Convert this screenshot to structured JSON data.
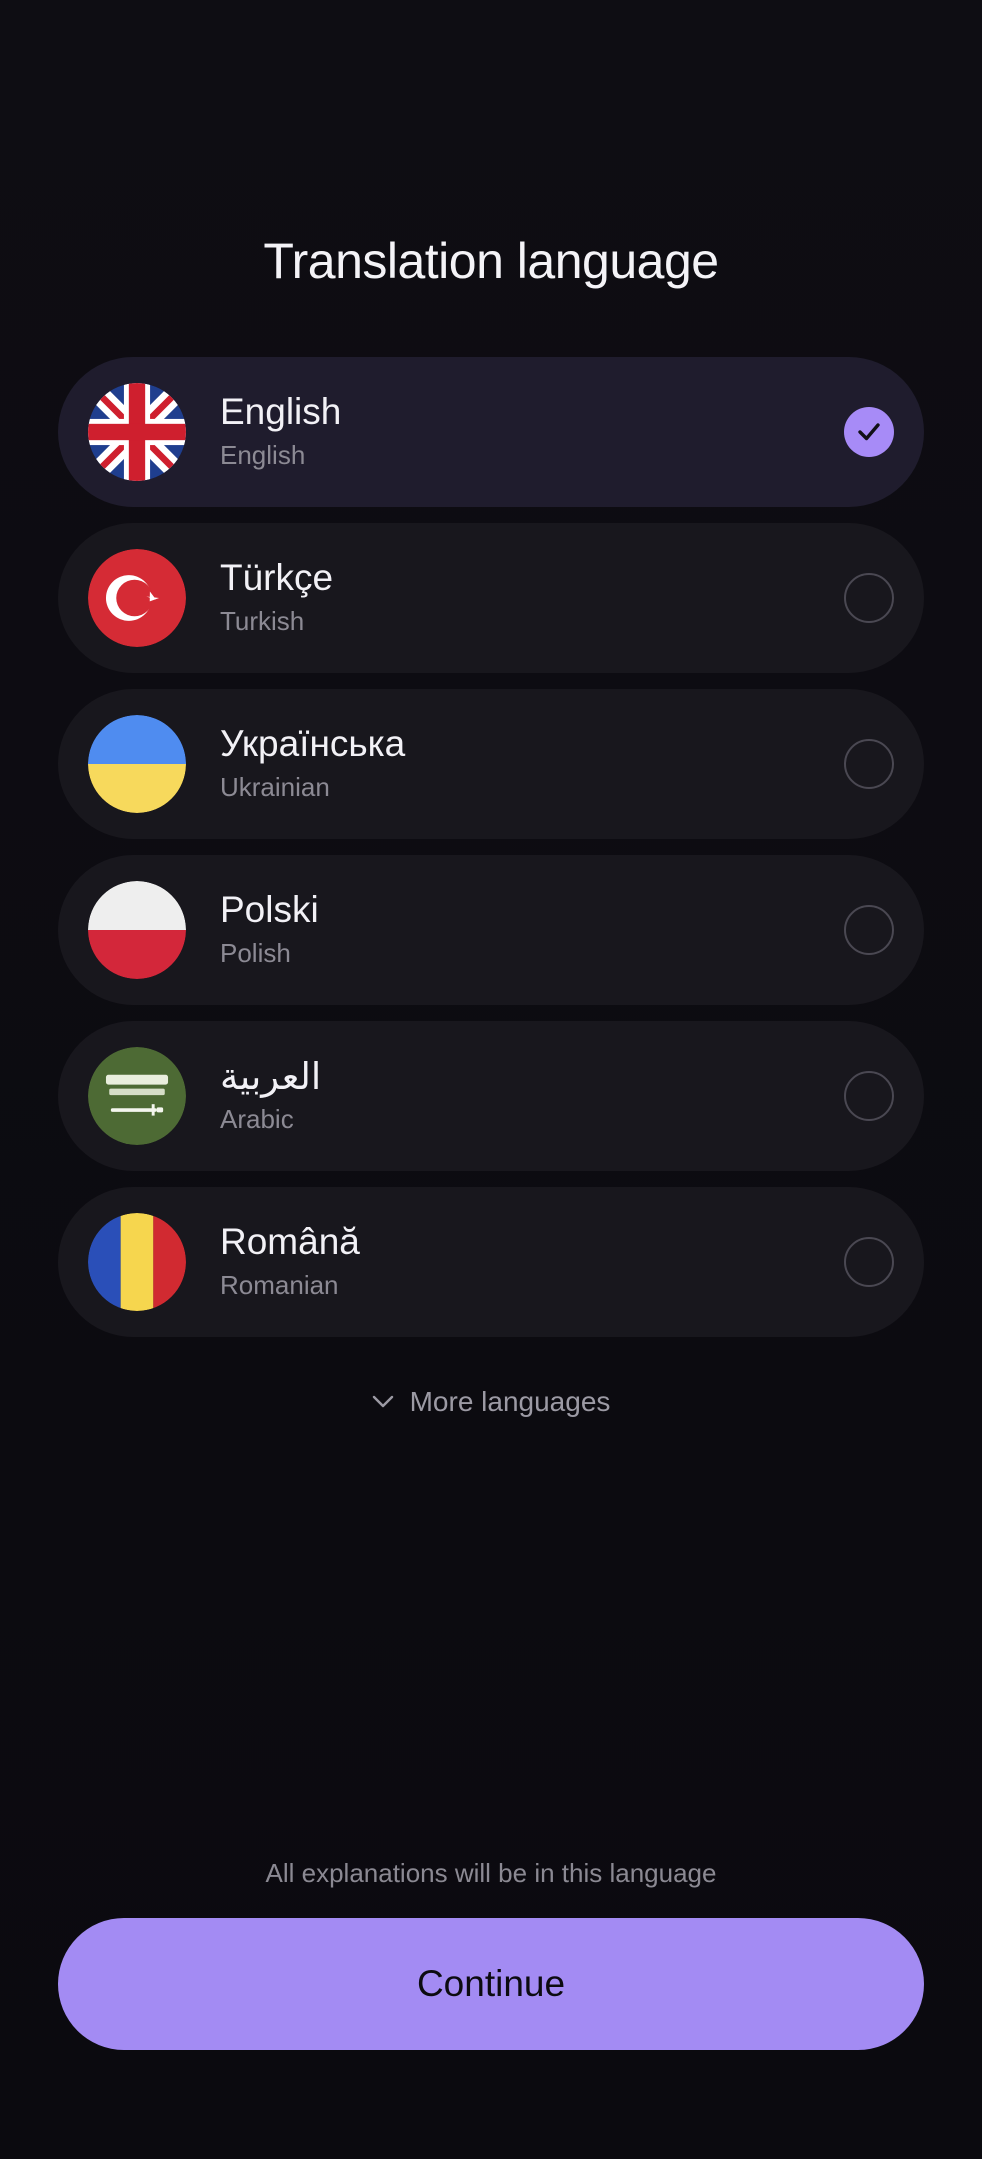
{
  "page": {
    "title": "Translation language",
    "more_label": "More languages",
    "hint": "All explanations will be in this language",
    "continue_label": "Continue"
  },
  "colors": {
    "accent": "#a38bf3",
    "background": "#0c0b10",
    "row": "#18171d",
    "row_selected": "#1f1c2d"
  },
  "languages": [
    {
      "native": "English",
      "english": "English",
      "flag": "uk-flag-icon",
      "selected": true
    },
    {
      "native": "Türkçe",
      "english": "Turkish",
      "flag": "turkey-flag-icon",
      "selected": false
    },
    {
      "native": "Українська",
      "english": "Ukrainian",
      "flag": "ukraine-flag-icon",
      "selected": false
    },
    {
      "native": "Polski",
      "english": "Polish",
      "flag": "poland-flag-icon",
      "selected": false
    },
    {
      "native": "العربية",
      "english": "Arabic",
      "flag": "saudi-flag-icon",
      "selected": false,
      "flag_text": "لا اله الا الله محمد رسول الله"
    },
    {
      "native": "Română",
      "english": "Romanian",
      "flag": "romania-flag-icon",
      "selected": false
    }
  ]
}
